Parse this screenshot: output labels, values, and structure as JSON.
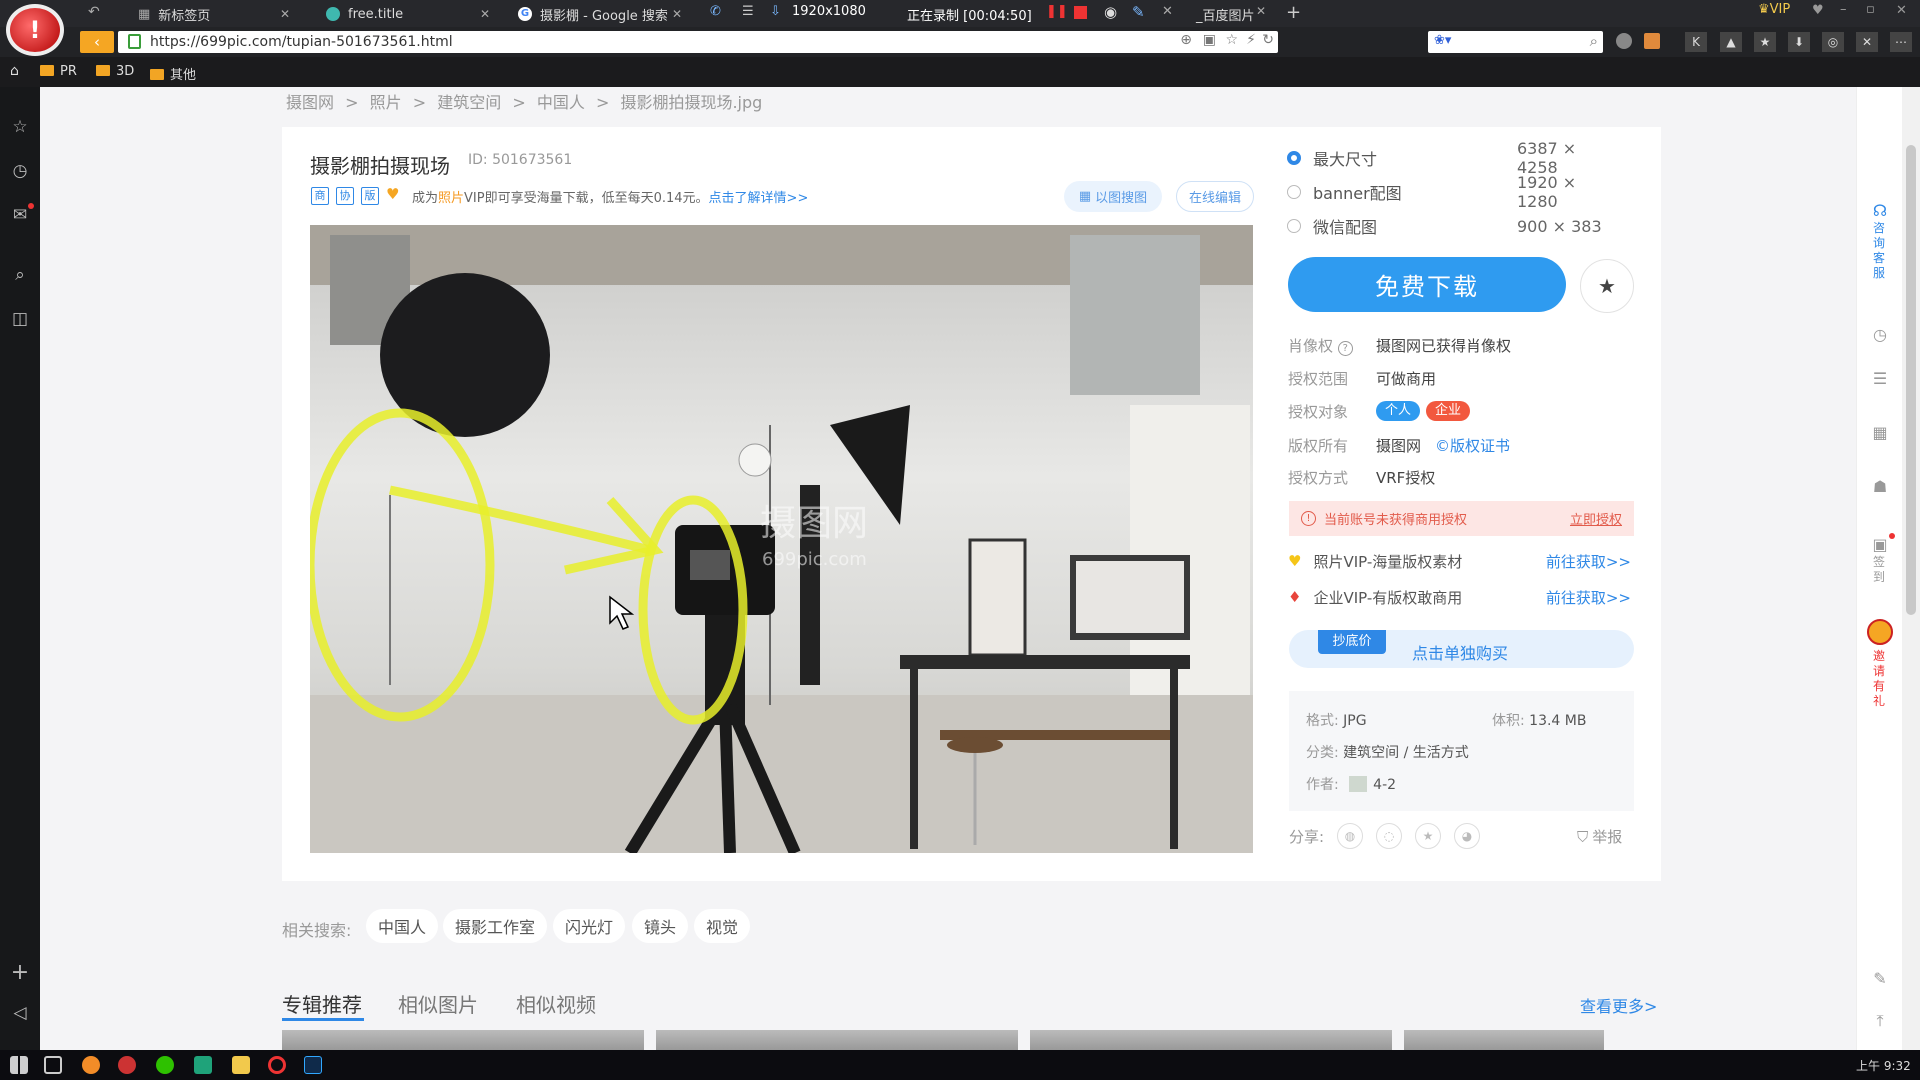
{
  "browser": {
    "tabs": [
      {
        "title": "新标签页"
      },
      {
        "title": "free.title"
      },
      {
        "title": "摄影棚 - Google 搜索"
      },
      {
        "title": "1920x1080"
      },
      {
        "title": "正在录制 [00:04:50]"
      },
      {
        "title": "_百度图片"
      }
    ],
    "vip_label": "VIP",
    "url": "https://699pic.com/tupian-501673561.html",
    "bookmarks": [
      {
        "label": "PR"
      },
      {
        "label": "3D"
      },
      {
        "label": "其他"
      }
    ]
  },
  "breadcrumb": {
    "items": [
      "摄图网",
      "照片",
      "建筑空间",
      "中国人",
      "摄影棚拍摄现场.jpg"
    ],
    "separator": ">"
  },
  "image": {
    "title": "摄影棚拍摄现场",
    "id_text": "ID: 501673561",
    "badges": [
      "商",
      "协",
      "版"
    ],
    "promo_prefix": "成为",
    "promo_highlight": "照片",
    "promo_middle": "VIP即可享受海量下载，低至每天0.14元。",
    "promo_link": "点击了解详情>>",
    "search_by_image": "以图搜图",
    "online_edit": "在线编辑",
    "watermark_brand": "摄图网",
    "watermark_url": "699pic.com"
  },
  "sizes": [
    {
      "label": "最大尺寸",
      "dims": "6387 × 4258",
      "selected": true
    },
    {
      "label": "banner配图",
      "dims": "1920 × 1280",
      "selected": false
    },
    {
      "label": "微信配图",
      "dims": "900 × 383",
      "selected": false
    }
  ],
  "download_label": "免费下载",
  "license": {
    "portrait_key": "肖像权",
    "portrait_val": "摄图网已获得肖像权",
    "scope_key": "授权范围",
    "scope_val": "可做商用",
    "target_key": "授权对象",
    "target_personal": "个人",
    "target_enterprise": "企业",
    "owner_key": "版权所有",
    "owner_val": "摄图网",
    "certificate": "版权证书",
    "method_key": "授权方式",
    "method_val": "VRF授权"
  },
  "warning": {
    "text": "当前账号未获得商用授权",
    "link": "立即授权"
  },
  "vip_offers": [
    {
      "text": "照片VIP-海量版权素材",
      "link": "前往获取>>",
      "icon_color": "#f5c518"
    },
    {
      "text": "企业VIP-有版权敢商用",
      "link": "前往获取>>",
      "icon_color": "#e8453c"
    }
  ],
  "buy": {
    "tag": "抄底价",
    "text": "点击单独购买"
  },
  "meta": {
    "format_key": "格式:",
    "format_val": "JPG",
    "size_key": "体积:",
    "size_val": "13.4 MB",
    "category_key": "分类:",
    "category_val": "建筑空间 / 生活方式",
    "author_key": "作者:",
    "author_val": "4-2"
  },
  "share_label": "分享:",
  "report_label": "举报",
  "related": {
    "label": "相关搜索:",
    "tags": [
      "中国人",
      "摄影工作室",
      "闪光灯",
      "镜头",
      "视觉"
    ]
  },
  "sections": {
    "tabs": [
      "专辑推荐",
      "相似图片",
      "相似视频"
    ],
    "active": 0,
    "more": "查看更多>"
  },
  "right_sidebar": {
    "consult": "咨询客服",
    "signin": "签到",
    "invite": "邀请有礼"
  },
  "taskbar": {
    "time": "上午 9:32"
  }
}
